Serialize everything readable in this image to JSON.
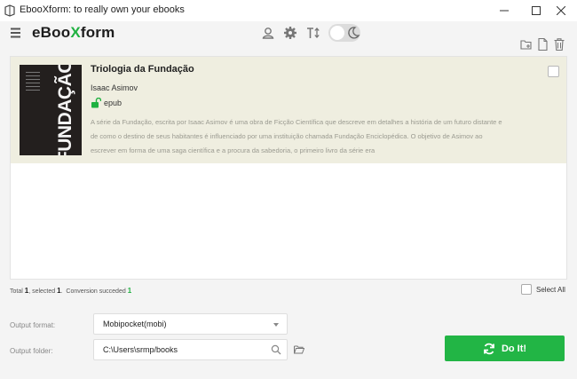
{
  "window": {
    "title": "EbooXform: to really own your ebooks",
    "icons": [
      "app-logo-icon",
      "minimize-icon",
      "maximize-icon",
      "close-icon"
    ]
  },
  "header": {
    "brand_prefix": "eBoo",
    "brand_x": "X",
    "brand_suffix": "form",
    "icons": [
      "menu-icon",
      "user-icon",
      "settings-icon",
      "font-size-icon",
      "theme-toggle",
      "moon-icon"
    ],
    "tools": [
      "add-folder-icon",
      "add-file-icon",
      "delete-icon"
    ]
  },
  "books": [
    {
      "title": "Triologia da Fundação",
      "author": "Isaac Asimov",
      "format": "epub",
      "cover_text": "FUNDAÇÃO",
      "description": "A série da Fundação, escrita por Isaac Asimov é uma obra de Ficção Científica que descreve em detalhes a história de um futuro distante e de como o destino de seus habitantes é influenciado por uma instituição chamada Fundação Enciclopédica. O objetivo de Asimov ao escrever em forma de uma saga científica e a procura da sabedoria, o primeiro livro da série era",
      "selected": false
    }
  ],
  "status": {
    "total_label": "Total",
    "total": "1",
    "selected_label": "selected",
    "selected": "1",
    "conversion_label": "Conversion succeded",
    "succeeded": "1"
  },
  "select_all_label": "Select All",
  "output": {
    "format_label": "Output format:",
    "format_value": "Mobipocket(mobi)",
    "folder_label": "Output folder:",
    "folder_value": "C:\\Users\\srmp/books"
  },
  "do_it_label": "Do It!",
  "colors": {
    "accent": "#22b545",
    "selected_row": "#efeee0",
    "background": "#f4f4f4"
  }
}
